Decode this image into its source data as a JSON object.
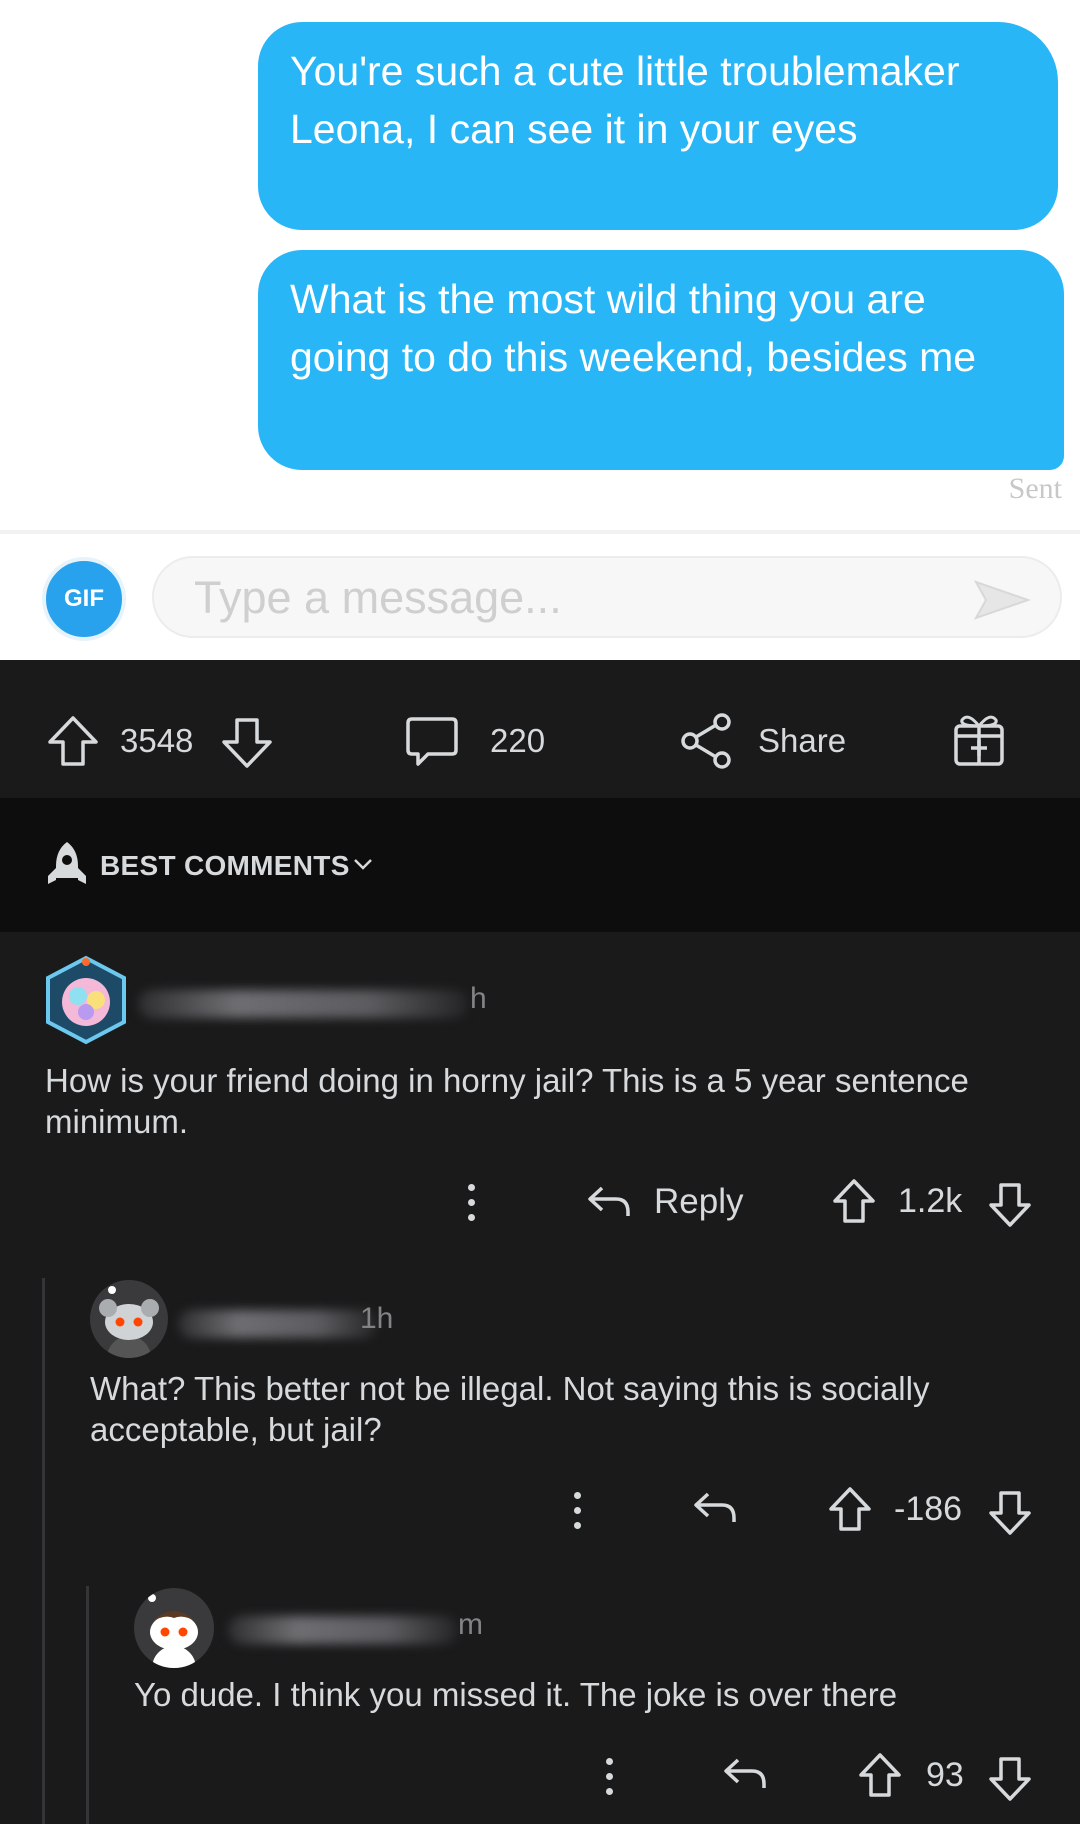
{
  "chat": {
    "messages": [
      "You're such a cute little troublemaker Leona, I can see it in your eyes",
      "What is the most wild thing you are going to do this weekend, besides me"
    ],
    "status": "Sent",
    "gif_label": "GIF",
    "input_placeholder": "Type a message..."
  },
  "post_actions": {
    "upvotes": "3548",
    "comments": "220",
    "share_label": "Share"
  },
  "sort": {
    "label": "BEST COMMENTS"
  },
  "comments": [
    {
      "age": "h",
      "body": "How is your friend doing in horny jail? This is a 5 year sentence minimum.",
      "reply_label": "Reply",
      "score": "1.2k"
    },
    {
      "age": "1h",
      "body": "What? This better not be illegal. Not saying this is socially acceptable, but jail?",
      "score": "-186"
    },
    {
      "age": "m",
      "body": "Yo dude. I think you missed it. The joke is over there",
      "score": "93"
    }
  ],
  "colors": {
    "bubble": "#29b6f6",
    "dark_bg": "#1a1a1b",
    "text": "#d7dadc"
  }
}
